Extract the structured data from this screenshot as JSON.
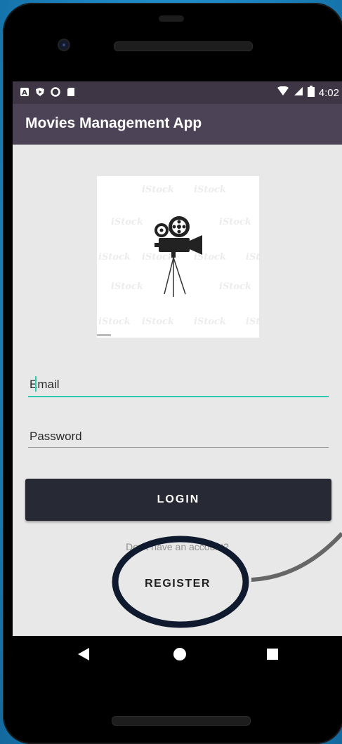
{
  "status_bar": {
    "time": "4:02",
    "left_icons": [
      "a-box-icon",
      "play-shield-icon",
      "circle-icon",
      "sd-card-icon"
    ],
    "right_icons": [
      "wifi-icon",
      "signal-icon",
      "battery-icon"
    ]
  },
  "app_bar": {
    "title": "Movies Management App"
  },
  "logo": {
    "icon": "movie-camera-icon"
  },
  "form": {
    "email_placeholder": "Email",
    "password_placeholder": "Password",
    "login_label": "LOGIN",
    "account_prompt": "Don't have an account?",
    "register_label": "REGISTER"
  },
  "nav_bar": {
    "back": "back-triangle-icon",
    "home": "home-circle-icon",
    "recents": "recents-square-icon"
  },
  "colors": {
    "status_bar": "#3e3645",
    "app_bar": "#4d4356",
    "accent": "#2bcbb0",
    "button": "#272a35",
    "background": "#1f8fc9",
    "annotation": "#0f1a2e"
  }
}
